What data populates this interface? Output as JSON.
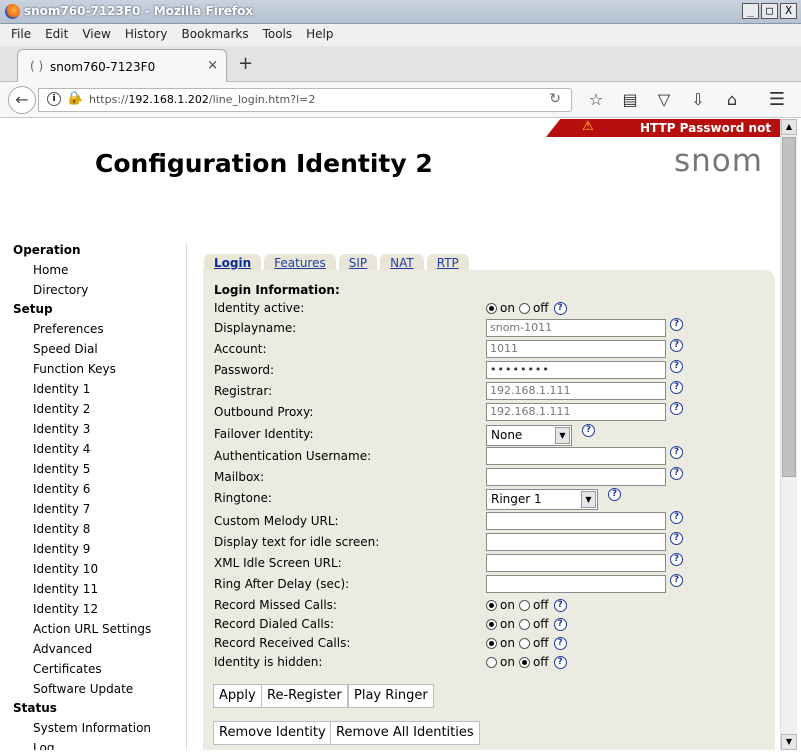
{
  "window": {
    "title": "snom760-7123F0 - Mozilla Firefox",
    "buttons": [
      "_",
      "□",
      "X"
    ]
  },
  "menu": [
    "File",
    "Edit",
    "View",
    "History",
    "Bookmarks",
    "Tools",
    "Help"
  ],
  "tab": {
    "title": "snom760-7123F0",
    "close": "×",
    "new": "+"
  },
  "address": {
    "prefix": "https://",
    "host": "192.168.1.202",
    "path": "/line_login.htm?l=2"
  },
  "banner": "HTTP Password not set!",
  "page_title": "Configuration Identity 2",
  "logo": "snom",
  "sidenav": [
    {
      "type": "sec",
      "label": "Operation"
    },
    {
      "type": "it",
      "label": "Home"
    },
    {
      "type": "it",
      "label": "Directory"
    },
    {
      "type": "sec",
      "label": "Setup"
    },
    {
      "type": "it",
      "label": "Preferences"
    },
    {
      "type": "it",
      "label": "Speed Dial"
    },
    {
      "type": "it",
      "label": "Function Keys"
    },
    {
      "type": "it",
      "label": "Identity 1"
    },
    {
      "type": "it",
      "label": "Identity 2"
    },
    {
      "type": "it",
      "label": "Identity 3"
    },
    {
      "type": "it",
      "label": "Identity 4"
    },
    {
      "type": "it",
      "label": "Identity 5"
    },
    {
      "type": "it",
      "label": "Identity 6"
    },
    {
      "type": "it",
      "label": "Identity 7"
    },
    {
      "type": "it",
      "label": "Identity 8"
    },
    {
      "type": "it",
      "label": "Identity 9"
    },
    {
      "type": "it",
      "label": "Identity 10"
    },
    {
      "type": "it",
      "label": "Identity 11"
    },
    {
      "type": "it",
      "label": "Identity 12"
    },
    {
      "type": "it",
      "label": "Action URL Settings"
    },
    {
      "type": "it",
      "label": "Advanced"
    },
    {
      "type": "it",
      "label": "Certificates"
    },
    {
      "type": "it",
      "label": "Software Update"
    },
    {
      "type": "sec",
      "label": "Status"
    },
    {
      "type": "it",
      "label": "System Information"
    },
    {
      "type": "it",
      "label": "Log"
    }
  ],
  "tabs": [
    "Login",
    "Features",
    "SIP",
    "NAT",
    "RTP"
  ],
  "section_heading": "Login Information:",
  "radio_on": "on",
  "radio_off": "off",
  "help": "?",
  "fields": {
    "identity_active": {
      "label": "Identity active:",
      "value": "on"
    },
    "displayname": {
      "label": "Displayname:",
      "value": "snom-1011"
    },
    "account": {
      "label": "Account:",
      "value": "1011"
    },
    "password": {
      "label": "Password:",
      "value": "••••••••"
    },
    "registrar": {
      "label": "Registrar:",
      "value": "192.168.1.111"
    },
    "outbound_proxy": {
      "label": "Outbound Proxy:",
      "value": "192.168.1.111"
    },
    "failover": {
      "label": "Failover Identity:",
      "value": "None"
    },
    "auth_user": {
      "label": "Authentication Username:",
      "value": ""
    },
    "mailbox": {
      "label": "Mailbox:",
      "value": ""
    },
    "ringtone": {
      "label": "Ringtone:",
      "value": "Ringer 1"
    },
    "melody_url": {
      "label": "Custom Melody URL:",
      "value": ""
    },
    "idle_text": {
      "label": "Display text for idle screen:",
      "value": ""
    },
    "xml_idle": {
      "label": "XML Idle Screen URL:",
      "value": ""
    },
    "ring_delay": {
      "label": "Ring After Delay (sec):",
      "value": ""
    },
    "missed": {
      "label": "Record Missed Calls:",
      "value": "on"
    },
    "dialed": {
      "label": "Record Dialed Calls:",
      "value": "on"
    },
    "received": {
      "label": "Record Received Calls:",
      "value": "on"
    },
    "hidden": {
      "label": "Identity is hidden:",
      "value": "off"
    }
  },
  "buttons": {
    "apply": "Apply",
    "reregister": "Re-Register",
    "play": "Play Ringer",
    "remove": "Remove Identity",
    "remove_all": "Remove All Identities"
  }
}
